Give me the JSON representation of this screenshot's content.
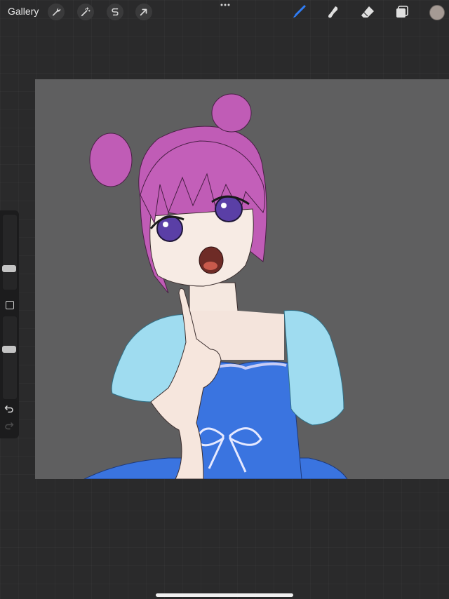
{
  "app": {
    "gallery_label": "Gallery"
  },
  "toolbar": {
    "left_tools": [
      {
        "name": "actions",
        "icon": "wrench-icon"
      },
      {
        "name": "adjustments",
        "icon": "magic-wand-icon"
      },
      {
        "name": "selection",
        "icon": "selection-s-icon"
      },
      {
        "name": "transform",
        "icon": "arrow-cursor-icon"
      }
    ],
    "more_icon": "more-dots-icon",
    "right_tools": [
      {
        "name": "brush",
        "icon": "brush-icon",
        "active": true
      },
      {
        "name": "smudge",
        "icon": "smudge-icon",
        "active": false
      },
      {
        "name": "eraser",
        "icon": "eraser-icon",
        "active": false
      },
      {
        "name": "layers",
        "icon": "layers-icon",
        "active": false
      }
    ],
    "current_color": "#a59a94",
    "active_tool_color": "#2f7df6"
  },
  "canvas": {
    "background_color": "#5f5f60",
    "artwork": "drawing-illustration"
  },
  "sidebar": {
    "brush_size_level": 0.25,
    "opacity_level": 0.6,
    "modify_icon": "square-modify-icon",
    "undo_icon": "undo-icon",
    "redo_icon": "redo-icon"
  }
}
